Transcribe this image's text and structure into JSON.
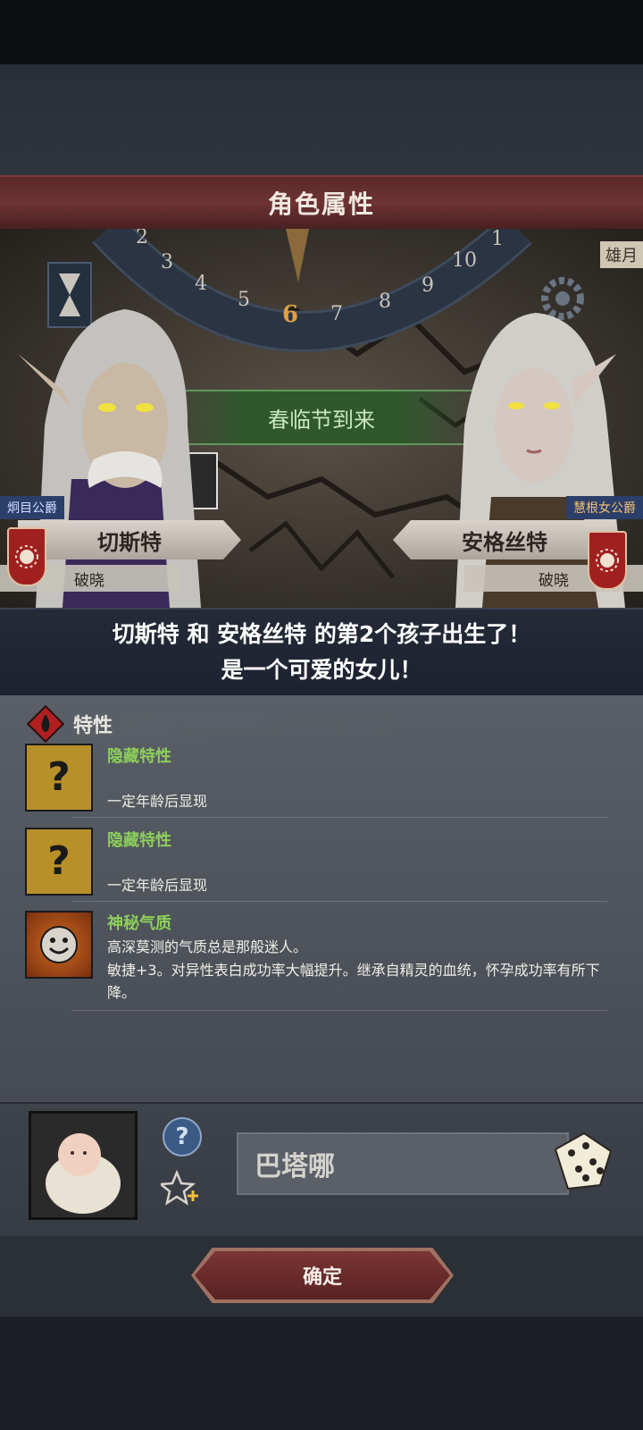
{
  "dialog": {
    "title": "角色属性"
  },
  "scene": {
    "calendar_numbers": [
      "2",
      "3",
      "4",
      "5",
      "6",
      "7",
      "8",
      "9",
      "10",
      "1"
    ],
    "current_month": "6",
    "moon_label": "雄月",
    "event": "春临节到来"
  },
  "father": {
    "title": "炯目公爵",
    "name": "切斯特",
    "house": "破晓"
  },
  "mother": {
    "title": "慧根女公爵",
    "name": "安格丝特",
    "house": "破晓"
  },
  "message": {
    "line1": "切斯特 和 安格丝特 的第2个孩子出生了！",
    "line2": "是一个可爱的女儿！"
  },
  "traits_section": {
    "label": "特性"
  },
  "traits": [
    {
      "name": "隐藏特性",
      "desc": "一定年龄后显现",
      "icon": "question-mark-icon"
    },
    {
      "name": "隐藏特性",
      "desc": "一定年龄后显现",
      "icon": "question-mark-icon"
    },
    {
      "name": "神秘气质",
      "desc1": "高深莫测的气质总是那般迷人。",
      "desc2": "敏捷+3。对异性表白成功率大幅提升。继承自精灵的血统，怀孕成功率有所下降。",
      "icon": "smiling-sun-icon"
    }
  ],
  "child": {
    "name_value": "巴塔哪",
    "help_symbol": "?"
  },
  "buttons": {
    "confirm": "确定"
  },
  "colors": {
    "accent_red": "#6e3232",
    "trait_green": "#8ccf5a",
    "event_green": "#2d6a2d"
  }
}
